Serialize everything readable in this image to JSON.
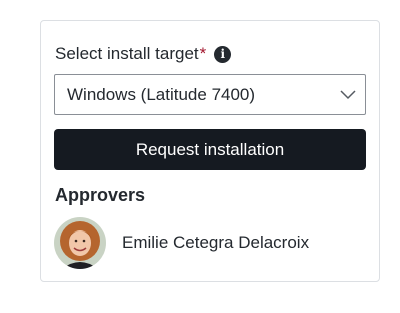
{
  "form": {
    "label": "Select install target",
    "required_marker": "*",
    "info_icon": "info-icon",
    "select_value": "Windows (Latitude 7400)",
    "chevron_icon": "chevron-down-icon"
  },
  "actions": {
    "request_label": "Request installation"
  },
  "approvers": {
    "title": "Approvers",
    "items": [
      {
        "name": "Emilie Cetegra Delacroix",
        "avatar": "avatar"
      }
    ]
  },
  "colors": {
    "required": "#a3172e",
    "button_bg": "#151a21",
    "button_text": "#ffffff"
  }
}
